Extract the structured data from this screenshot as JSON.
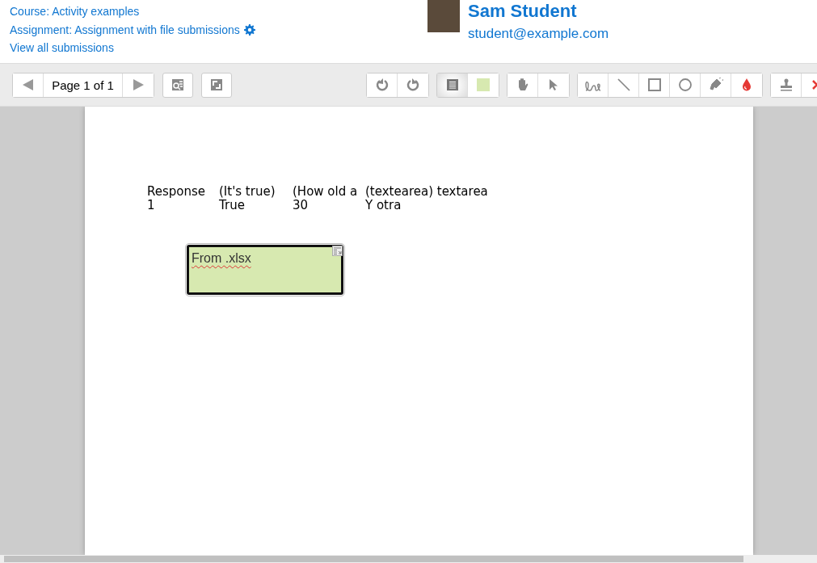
{
  "header": {
    "links": [
      "Course: Activity examples",
      "Assignment: Assignment with file submissions",
      "View all submissions"
    ],
    "user": {
      "name": "Sam Student",
      "email": "student@example.com"
    }
  },
  "toolbar": {
    "page_label": "Page 1 of 1",
    "groups": [
      {
        "tools": [
          {
            "kind": "rotate-left",
            "selected": false
          },
          {
            "kind": "rotate-right",
            "selected": false
          }
        ]
      },
      {
        "tools": [
          {
            "kind": "comment",
            "selected": true
          },
          {
            "kind": "comment-color",
            "selected": false,
            "color": "#d7e9b0"
          }
        ]
      },
      {
        "tools": [
          {
            "kind": "pan",
            "selected": false
          },
          {
            "kind": "select",
            "selected": false
          }
        ]
      },
      {
        "tools": [
          {
            "kind": "pen",
            "selected": false
          },
          {
            "kind": "line",
            "selected": false
          },
          {
            "kind": "rectangle",
            "selected": false
          },
          {
            "kind": "oval",
            "selected": false
          },
          {
            "kind": "highlight",
            "selected": false
          },
          {
            "kind": "annotation-color",
            "selected": false,
            "color": "#e53935"
          }
        ]
      },
      {
        "tools": [
          {
            "kind": "stamp",
            "selected": false
          },
          {
            "kind": "delete",
            "selected": false
          }
        ]
      }
    ]
  },
  "document": {
    "rows": [
      [
        "Response",
        "(It's true)",
        "(How old a",
        "(textearea) textarea"
      ],
      [
        "1",
        "True",
        "30",
        "Y otra"
      ]
    ],
    "comment": {
      "text": "From .xlsx",
      "color": "#d7e9b0"
    }
  }
}
